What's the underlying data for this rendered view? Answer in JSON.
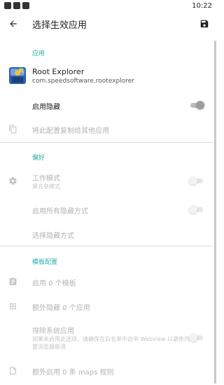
{
  "status_bar": {
    "time": "10:22"
  },
  "appbar": {
    "title": "选择生效应用"
  },
  "sections": {
    "app": {
      "header": "应用",
      "app_name": "Root Explorer",
      "package": "com.speedsoftware.rootexplorer",
      "enable_hide_label": "启用隐藏",
      "enable_hide_on": true,
      "copy_config_label": "将此配置复制给其他应用"
    },
    "prefs": {
      "header": "偏好",
      "work_mode_label": "工作模式",
      "work_mode_value": "黑名单模式",
      "work_mode_on": false,
      "all_hide_label": "启用所有隐藏方式",
      "all_hide_on": false,
      "choose_hide_label": "选择隐藏方式"
    },
    "templates": {
      "header": "模板配置",
      "enable_templates_label": "启用 0 个模板",
      "extra_hide_label": "额外隐藏 0 个应用",
      "exclude_system_label": "排除系统应用",
      "exclude_system_desc": "如果未启用此选项，请确保在白名单中选中 Webview 以避免内置浏览器崩溃",
      "exclude_system_on": false,
      "extra_maps_label": "额外启用 0 条 maps 规则"
    }
  },
  "icons": {
    "back": "arrow-left-icon",
    "save": "save-icon",
    "copy": "copy-icon",
    "settings": "gear-icon",
    "template": "clipboard-icon",
    "grid": "grid-icon",
    "file": "file-icon"
  },
  "colors": {
    "accent": "#26b0a5",
    "disabled_text": "#b4b4b4"
  }
}
